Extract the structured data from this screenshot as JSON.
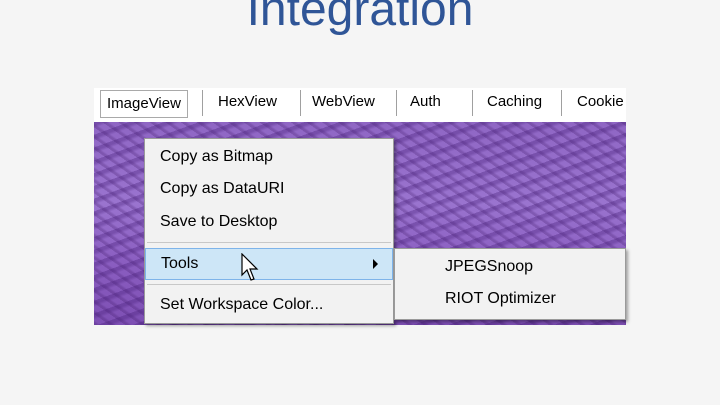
{
  "slide": {
    "title": "Integration"
  },
  "tabs": [
    {
      "label": "ImageView"
    },
    {
      "label": "HexView"
    },
    {
      "label": "WebView"
    },
    {
      "label": "Auth"
    },
    {
      "label": "Caching"
    },
    {
      "label": "Cookie"
    }
  ],
  "context_menu": {
    "items": [
      {
        "label": "Copy as Bitmap"
      },
      {
        "label": "Copy as DataURI"
      },
      {
        "label": "Save to Desktop"
      },
      {
        "label": "Tools"
      },
      {
        "label": "Set Workspace Color..."
      }
    ]
  },
  "tools_submenu": {
    "items": [
      {
        "label": "JPEGSnoop"
      },
      {
        "label": "RIOT Optimizer"
      }
    ]
  },
  "colors": {
    "title": "#2f5597",
    "highlight": "#cde6f7",
    "highlight_border": "#7eb4ea"
  },
  "icons": {
    "cursor": "arrow-cursor-icon",
    "submenu": "submenu-arrow-icon"
  }
}
